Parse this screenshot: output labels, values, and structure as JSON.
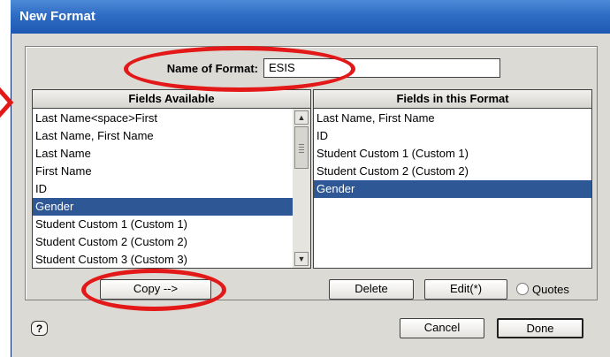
{
  "window": {
    "title": "New Format"
  },
  "format_name": {
    "label": "Name of Format:",
    "value": "ESIS"
  },
  "fields_available": {
    "header": "Fields Available",
    "items": [
      {
        "label": "Last Name<space>First",
        "selected": false
      },
      {
        "label": "Last Name, First Name",
        "selected": false
      },
      {
        "label": "Last Name",
        "selected": false
      },
      {
        "label": "First Name",
        "selected": false
      },
      {
        "label": "ID",
        "selected": false
      },
      {
        "label": "Gender",
        "selected": true
      },
      {
        "label": "Student Custom 1 (Custom 1)",
        "selected": false
      },
      {
        "label": "Student Custom 2 (Custom 2)",
        "selected": false
      },
      {
        "label": "Student Custom 3 (Custom 3)",
        "selected": false
      }
    ]
  },
  "fields_in_format": {
    "header": "Fields in this Format",
    "items": [
      {
        "label": "Last Name, First Name",
        "selected": false
      },
      {
        "label": "ID",
        "selected": false
      },
      {
        "label": "Student Custom 1 (Custom 1)",
        "selected": false
      },
      {
        "label": "Student Custom 2 (Custom 2)",
        "selected": false
      },
      {
        "label": "Gender",
        "selected": true
      }
    ]
  },
  "buttons": {
    "copy": "Copy -->",
    "delete": "Delete",
    "edit": "Edit(*)",
    "quotes": "Quotes",
    "cancel": "Cancel",
    "done": "Done",
    "help": "?"
  },
  "options": {
    "quotes_checked": false
  },
  "icons": {
    "scroll_up": "scroll-up-arrow-icon",
    "scroll_down": "scroll-down-arrow-icon",
    "help": "help-icon"
  },
  "colors": {
    "title_bar": "#2f6cc4",
    "selection": "#2e5795",
    "annotation": "#e31818",
    "dialog_bg": "#dcdad5"
  }
}
